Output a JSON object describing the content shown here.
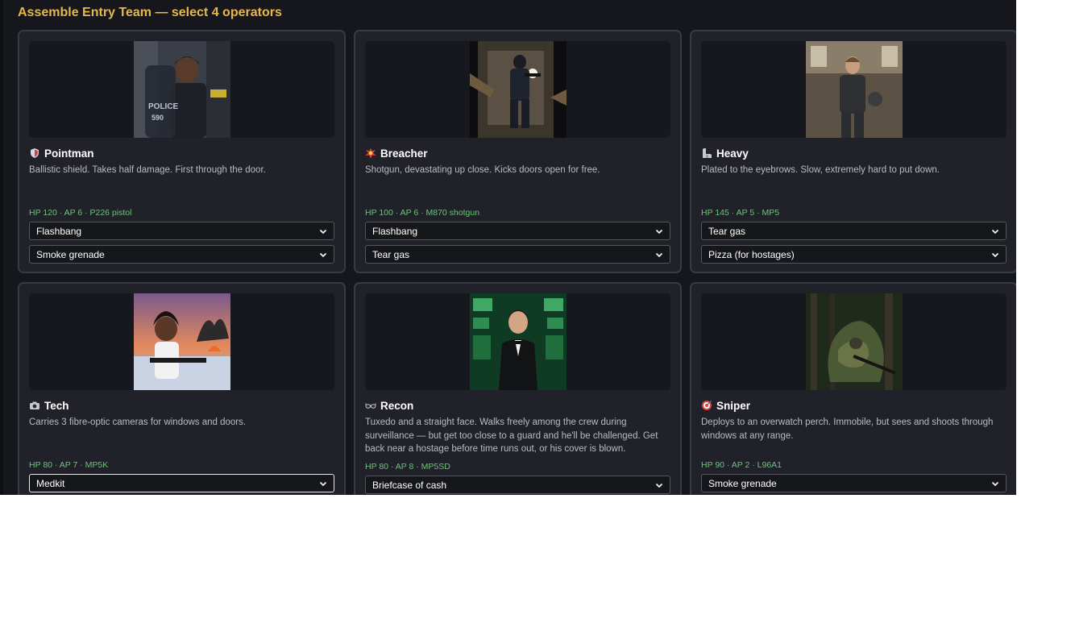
{
  "title": "Assemble Entry Team — select 4 operators",
  "operators": [
    {
      "name": "Pointman",
      "icon": "shield-icon",
      "description": "Ballistic shield. Takes half damage. First through the door.",
      "stats": "HP 120 · AP 6 · P226 pistol",
      "gear": [
        "Flashbang",
        "Smoke grenade"
      ]
    },
    {
      "name": "Breacher",
      "icon": "explosion-icon",
      "description": "Shotgun, devastating up close. Kicks doors open for free.",
      "stats": "HP 100 · AP 6 · M870 shotgun",
      "gear": [
        "Flashbang",
        "Tear gas"
      ]
    },
    {
      "name": "Heavy",
      "icon": "flexed-arm-icon",
      "description": "Plated to the eyebrows. Slow, extremely hard to put down.",
      "stats": "HP 145 · AP 5 · MP5",
      "gear": [
        "Tear gas",
        "Pizza (for hostages)"
      ]
    },
    {
      "name": "Tech",
      "icon": "camera-icon",
      "description": "Carries 3 fibre-optic cameras for windows and doors.",
      "stats": "HP 80 · AP 7 · MP5K",
      "gear": [
        "Medkit"
      ]
    },
    {
      "name": "Recon",
      "icon": "sunglasses-icon",
      "description": "Tuxedo and a straight face. Walks freely among the crew during surveillance — but get too close to a guard and he'll be challenged. Get back near a hostage before time runs out, or his cover is blown.",
      "stats": "HP 80 · AP 8 · MP5SD",
      "gear": [
        "Briefcase of cash"
      ]
    },
    {
      "name": "Sniper",
      "icon": "target-icon",
      "description": "Deploys to an overwatch perch. Immobile, but sees and shoots through windows at any range.",
      "stats": "HP 90 · AP 2 · L96A1",
      "gear": [
        "Smoke grenade"
      ]
    }
  ],
  "colors": {
    "title": "#e8b74a",
    "stats": "#6ec27a",
    "card_bg": "#212229",
    "page_bg": "#16171c"
  }
}
